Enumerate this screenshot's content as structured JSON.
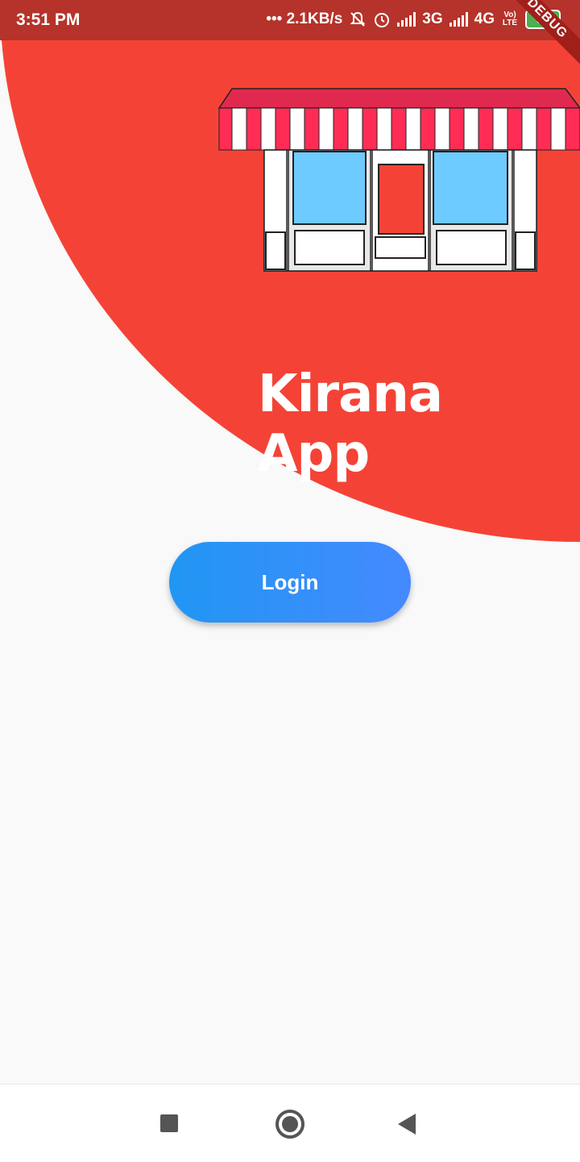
{
  "status_bar": {
    "time": "3:51 PM",
    "speed": "••• 2.1KB/s",
    "net1": "3G",
    "net2": "4G",
    "volte": "Vo) LTE",
    "battery": "84",
    "debug_label": "DEBUG"
  },
  "app": {
    "title": "Kirana App",
    "login_label": "Login",
    "colors": {
      "primary": "#f44336",
      "button_start": "#2196f3",
      "button_end": "#448aff"
    }
  },
  "icons": {
    "mute": "bell-off-icon",
    "alarm": "alarm-icon",
    "signal": "signal-icon"
  }
}
